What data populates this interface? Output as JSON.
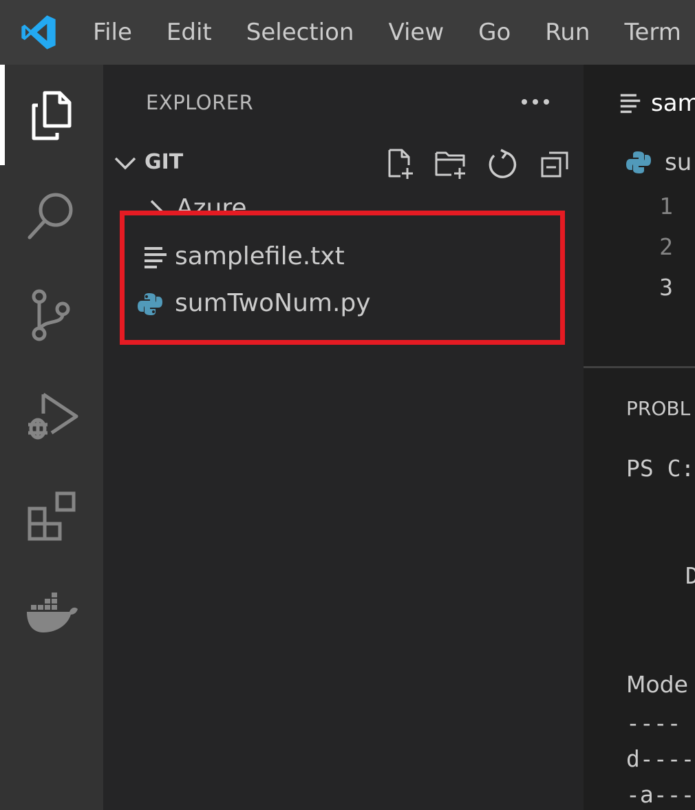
{
  "menu": [
    "File",
    "Edit",
    "Selection",
    "View",
    "Go",
    "Run",
    "Term"
  ],
  "activity_bar": {
    "items": [
      "explorer-icon",
      "search-icon",
      "source-control-icon",
      "run-debug-icon",
      "extensions-icon",
      "docker-icon"
    ],
    "active": "explorer-icon"
  },
  "sidebar": {
    "title": "EXPLORER",
    "more": "···",
    "section": {
      "title": "GIT",
      "actions": [
        "new-file-icon",
        "new-folder-icon",
        "refresh-icon",
        "collapse-all-icon"
      ]
    },
    "tree": [
      {
        "label": "Azure",
        "type": "folder"
      },
      {
        "label": "samplefile.txt",
        "type": "text-file"
      },
      {
        "label": "sumTwoNum.py",
        "type": "python-file"
      }
    ]
  },
  "editor": {
    "tab_label": "sam",
    "breadcrumb": "su",
    "line_numbers": [
      "1",
      "2",
      "3"
    ],
    "current_line": "3"
  },
  "panel": {
    "tab": "PROBL",
    "lines": [
      "PS C:",
      "D",
      "Mode",
      "----",
      "d----",
      "-a---"
    ]
  },
  "colors": {
    "highlight": "#e51b23",
    "vscode_blue": "#23a9f2",
    "python_blue": "#519aba"
  }
}
